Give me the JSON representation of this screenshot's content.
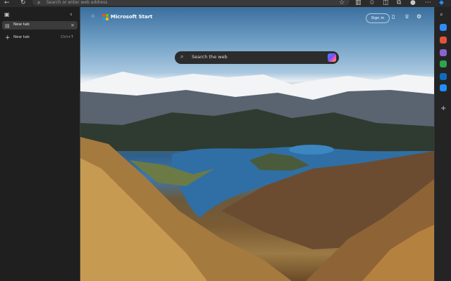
{
  "browser": {
    "address_placeholder": "Search or enter web address"
  },
  "sidebar": {
    "tabs": [
      {
        "label": "New tab"
      }
    ],
    "new_tab": {
      "label": "New tab",
      "shortcut": "Ctrl+T"
    }
  },
  "newtab_page": {
    "brand": "Microsoft Start",
    "sign_in": "Sign in",
    "search_placeholder": "Search the web"
  },
  "colors": {
    "accent_blue": "#0a84ff",
    "panel_dark": "#1f1f1f"
  },
  "icons": [
    "back-icon",
    "refresh-icon",
    "search-icon",
    "star-icon",
    "split-screen-icon",
    "favorites-icon",
    "collections-icon",
    "extensions-icon",
    "profile-icon",
    "more-icon",
    "copilot-icon",
    "apps-grid-icon",
    "settings-icon",
    "trophy-icon",
    "phone-icon",
    "add-icon"
  ]
}
